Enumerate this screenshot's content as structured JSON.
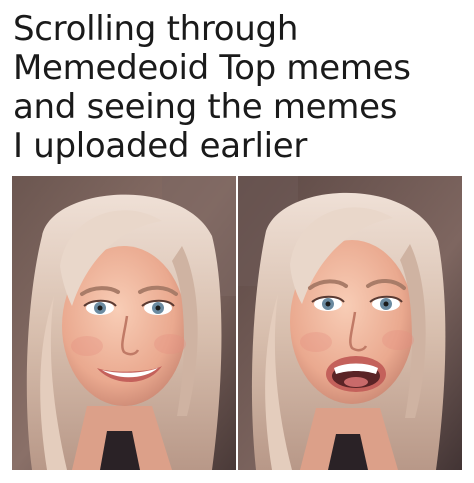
{
  "caption": {
    "lines": [
      "Scrolling through",
      "Memedeoid Top memes",
      "and seeing the memes",
      "I uploaded earlier"
    ]
  },
  "panels": [
    {
      "icon": "smiling-woman-photo",
      "expression": "smile"
    },
    {
      "icon": "laughing-woman-photo",
      "expression": "open-mouth-laugh"
    }
  ],
  "colors": {
    "background": "#ffffff",
    "text": "#1a1a1a",
    "hair": "#d8c2b3",
    "skin": "#f0b8a0",
    "backdrop": "#5e4a44",
    "lips": "#c4615b"
  }
}
